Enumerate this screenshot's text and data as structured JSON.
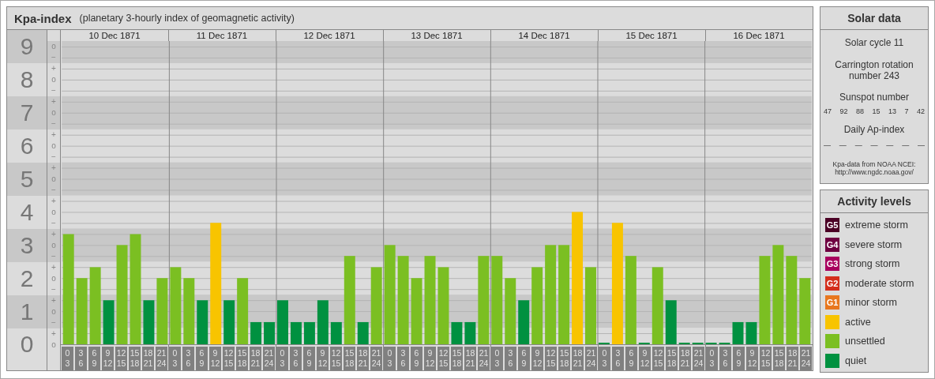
{
  "kpa_panel": {
    "title": "Kpa-index",
    "subtitle": "(planetary 3-hourly index of geomagnetic activity)",
    "days": [
      "10 Dec 1871",
      "11 Dec 1871",
      "12 Dec 1871",
      "13 Dec 1871",
      "14 Dec 1871",
      "15 Dec 1871",
      "16 Dec 1871"
    ],
    "minor_tick_labels": [
      "o",
      "−",
      "+",
      "o",
      "−",
      "+",
      "o",
      "−",
      "+",
      "o",
      "−",
      "+",
      "o",
      "−",
      "+",
      "o",
      "−",
      "+",
      "o",
      "−",
      "+",
      "o",
      "−",
      "+",
      "o",
      "−",
      "+",
      "o"
    ],
    "chart_data": {
      "type": "bar",
      "grid": true,
      "ylim": [
        0,
        9.17
      ],
      "yticks": [
        {
          "value": 9,
          "label": "9"
        },
        {
          "value": 8,
          "label": "8"
        },
        {
          "value": 7,
          "label": "7"
        },
        {
          "value": 6,
          "label": "6"
        },
        {
          "value": 5,
          "label": "5"
        },
        {
          "value": 4,
          "label": "4"
        },
        {
          "value": 3,
          "label": "3"
        },
        {
          "value": 2,
          "label": "2"
        },
        {
          "value": 1,
          "label": "1"
        },
        {
          "value": 0,
          "label": "0"
        }
      ],
      "categories": [
        "0 3",
        "3 6",
        "6 9",
        "9 12",
        "12 15",
        "15 18",
        "18 21",
        "21 24",
        "0 3",
        "3 6",
        "6 9",
        "9 12",
        "12 15",
        "15 18",
        "18 21",
        "21 24",
        "0 3",
        "3 6",
        "6 9",
        "9 12",
        "12 15",
        "15 18",
        "18 21",
        "21 24",
        "0 3",
        "3 6",
        "6 9",
        "9 12",
        "12 15",
        "15 18",
        "18 21",
        "21 24",
        "0 3",
        "3 6",
        "6 9",
        "9 12",
        "12 15",
        "15 18",
        "18 21",
        "21 24",
        "0 3",
        "3 6",
        "6 9",
        "9 12",
        "12 15",
        "15 18",
        "18 21",
        "21 24",
        "0 3",
        "3 6",
        "6 9",
        "9 12",
        "12 15",
        "15 18",
        "18 21",
        "21 24"
      ],
      "series": [
        {
          "color": "#009140",
          "values": [
            null,
            null,
            null,
            1.33,
            null,
            null,
            1.33,
            null,
            null,
            null,
            1.33,
            null,
            1.33,
            null,
            0.67,
            0.67,
            1.33,
            0.67,
            0.67,
            1.33,
            0.67,
            null,
            0.67,
            null,
            null,
            null,
            null,
            null,
            null,
            0.67,
            0.67,
            null,
            null,
            null,
            1.33,
            null,
            null,
            null,
            null,
            null,
            0,
            null,
            null,
            0,
            null,
            1.33,
            0,
            0,
            0,
            0,
            0.67,
            0.67,
            null,
            null,
            null,
            null
          ]
        },
        {
          "color": "#7bbf22",
          "values": [
            3.33,
            2,
            2.33,
            null,
            3,
            3.33,
            null,
            2,
            2.33,
            2,
            null,
            null,
            null,
            2,
            null,
            null,
            null,
            null,
            null,
            null,
            null,
            2.67,
            null,
            2.33,
            3,
            2.67,
            2,
            2.67,
            2.33,
            null,
            null,
            2.67,
            2.67,
            2,
            null,
            2.33,
            3,
            3,
            null,
            2.33,
            null,
            null,
            2.67,
            null,
            2.33,
            null,
            null,
            null,
            null,
            null,
            null,
            null,
            2.67,
            3,
            2.67,
            2
          ]
        },
        {
          "color": "#f8c400",
          "values": [
            null,
            null,
            null,
            null,
            null,
            null,
            null,
            null,
            null,
            null,
            null,
            3.67,
            null,
            null,
            null,
            null,
            null,
            null,
            null,
            null,
            null,
            null,
            null,
            null,
            null,
            null,
            null,
            null,
            null,
            null,
            null,
            null,
            null,
            null,
            null,
            null,
            null,
            null,
            4,
            null,
            null,
            3.67,
            null,
            null,
            null,
            null,
            null,
            null,
            null,
            null,
            null,
            null,
            null,
            null,
            null,
            null
          ]
        }
      ]
    }
  },
  "solar_data": {
    "title": "Solar data",
    "cycle": "Solar cycle 11",
    "rotation": "Carrington rotation number 243",
    "sunspot_label": "Sunspot number",
    "sunspot_numbers": [
      "47",
      "92",
      "88",
      "15",
      "13",
      "7",
      "42"
    ],
    "ap_label": "Daily Ap-index",
    "ap_values": [
      "—",
      "—",
      "—",
      "—",
      "—",
      "—",
      "—"
    ],
    "source_lines": [
      "Kpa-data from NOAA NCEI:",
      "http://www.ngdc.noaa.gov/"
    ]
  },
  "activity_levels": {
    "title": "Activity levels",
    "items": [
      {
        "badge": "G5",
        "label": "extreme storm",
        "color": "#4b0025"
      },
      {
        "badge": "G4",
        "label": "severe storm",
        "color": "#6e0040"
      },
      {
        "badge": "G3",
        "label": "strong storm",
        "color": "#a8005e"
      },
      {
        "badge": "G2",
        "label": "moderate storm",
        "color": "#d42e1c"
      },
      {
        "badge": "G1",
        "label": "minor storm",
        "color": "#e8771e"
      },
      {
        "label": "active",
        "color": "#f8c400"
      },
      {
        "label": "unsettled",
        "color": "#7bbf22"
      },
      {
        "label": "quiet",
        "color": "#009140"
      }
    ]
  }
}
